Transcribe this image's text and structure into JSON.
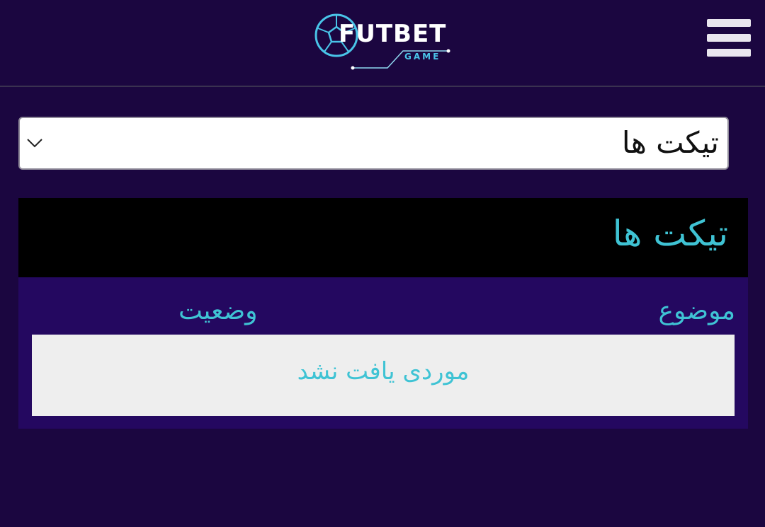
{
  "header": {
    "logo_text": "FUTBET",
    "logo_subtext": "GAME",
    "menu_icon": "hamburger-menu-icon"
  },
  "colors": {
    "background": "#1b0640",
    "panel_header_bg": "#000000",
    "panel_body_bg": "#240860",
    "accent_text": "#3fc3d4",
    "logo_accent": "#49c4e8",
    "empty_row_bg": "#eeeeee"
  },
  "section_select": {
    "selected_value": "تیکت ها",
    "icon": "chevron-down-icon"
  },
  "tickets_panel": {
    "title": "تیکت ها",
    "columns": [
      "موضوع",
      "وضعیت"
    ],
    "empty_message": "موردی یافت نشد"
  }
}
